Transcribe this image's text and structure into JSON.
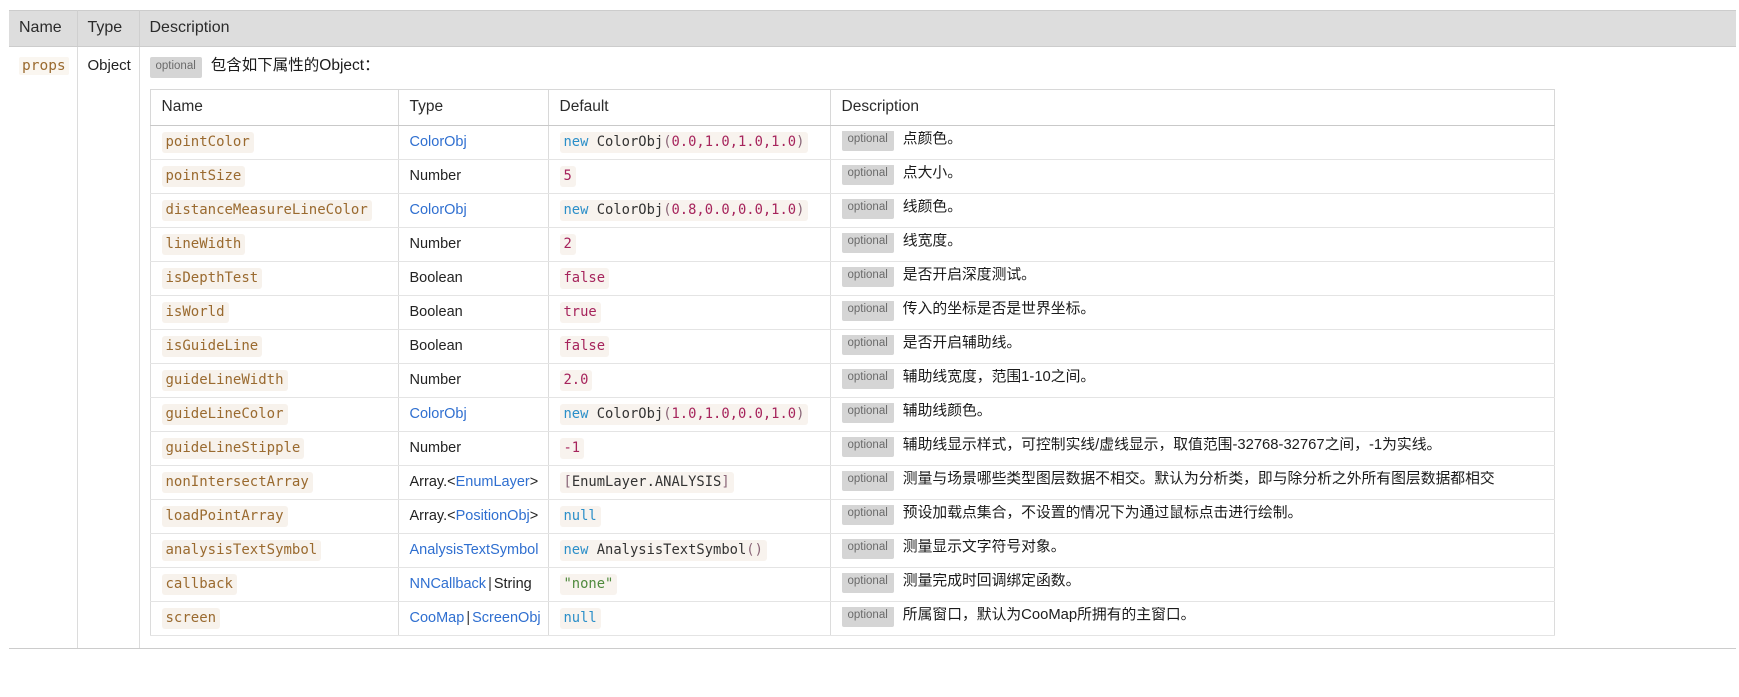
{
  "outer_table": {
    "headers": [
      "Name",
      "Type",
      "Description"
    ],
    "row": {
      "name": "props",
      "type": "Object",
      "optional_badge": "optional",
      "description": "包含如下属性的Object："
    }
  },
  "inner_table": {
    "headers": [
      "Name",
      "Type",
      "Default",
      "Description"
    ],
    "optional_badge": "optional",
    "rows": [
      {
        "name": "pointColor",
        "type": {
          "text": "ColorObj",
          "link": true
        },
        "default": {
          "text": "new ColorObj(0.0,1.0,1.0,1.0)",
          "tokens": [
            [
              "kw",
              "new"
            ],
            [
              "sp",
              " "
            ],
            [
              "id",
              "ColorObj"
            ],
            [
              "pun",
              "("
            ],
            [
              "num",
              "0.0,1.0,1.0,1.0"
            ],
            [
              "pun",
              ")"
            ]
          ]
        },
        "description": "点颜色。"
      },
      {
        "name": "pointSize",
        "type": {
          "text": "Number",
          "link": false
        },
        "default": {
          "text": "5",
          "tokens": [
            [
              "num",
              "5"
            ]
          ]
        },
        "description": "点大小。"
      },
      {
        "name": "distanceMeasureLineColor",
        "type": {
          "text": "ColorObj",
          "link": true
        },
        "default": {
          "text": "new ColorObj(0.8,0.0,0.0,1.0)",
          "tokens": [
            [
              "kw",
              "new"
            ],
            [
              "sp",
              " "
            ],
            [
              "id",
              "ColorObj"
            ],
            [
              "pun",
              "("
            ],
            [
              "num",
              "0.8,0.0,0.0,1.0"
            ],
            [
              "pun",
              ")"
            ]
          ]
        },
        "description": "线颜色。"
      },
      {
        "name": "lineWidth",
        "type": {
          "text": "Number",
          "link": false
        },
        "default": {
          "text": "2",
          "tokens": [
            [
              "num",
              "2"
            ]
          ]
        },
        "description": "线宽度。"
      },
      {
        "name": "isDepthTest",
        "type": {
          "text": "Boolean",
          "link": false
        },
        "default": {
          "text": "false",
          "tokens": [
            [
              "num",
              "false"
            ]
          ]
        },
        "description": "是否开启深度测试。"
      },
      {
        "name": "isWorld",
        "type": {
          "text": "Boolean",
          "link": false
        },
        "default": {
          "text": "true",
          "tokens": [
            [
              "num",
              "true"
            ]
          ]
        },
        "description": "传入的坐标是否是世界坐标。"
      },
      {
        "name": "isGuideLine",
        "type": {
          "text": "Boolean",
          "link": false
        },
        "default": {
          "text": "false",
          "tokens": [
            [
              "num",
              "false"
            ]
          ]
        },
        "description": "是否开启辅助线。"
      },
      {
        "name": "guideLineWidth",
        "type": {
          "text": "Number",
          "link": false
        },
        "default": {
          "text": "2.0",
          "tokens": [
            [
              "num",
              "2.0"
            ]
          ]
        },
        "description": "辅助线宽度，范围1-10之间。"
      },
      {
        "name": "guideLineColor",
        "type": {
          "text": "ColorObj",
          "link": true
        },
        "default": {
          "text": "new ColorObj(1.0,1.0,0.0,1.0)",
          "tokens": [
            [
              "kw",
              "new"
            ],
            [
              "sp",
              " "
            ],
            [
              "id",
              "ColorObj"
            ],
            [
              "pun",
              "("
            ],
            [
              "num",
              "1.0,1.0,0.0,1.0"
            ],
            [
              "pun",
              ")"
            ]
          ]
        },
        "description": "辅助线颜色。"
      },
      {
        "name": "guideLineStipple",
        "type": {
          "text": "Number",
          "link": false
        },
        "default": {
          "text": "-1",
          "tokens": [
            [
              "num",
              "-1"
            ]
          ]
        },
        "description": "辅助线显示样式，可控制实线/虚线显示，取值范围-32768-32767之间，-1为实线。"
      },
      {
        "name": "nonIntersectArray",
        "type": {
          "text": "Array.<EnumLayer>",
          "prefix": "Array.<",
          "link_text": "EnumLayer",
          "suffix": ">",
          "link": true
        },
        "default": {
          "text": "[EnumLayer.ANALYSIS]",
          "tokens": [
            [
              "pun",
              "["
            ],
            [
              "id",
              "EnumLayer.ANALYSIS"
            ],
            [
              "pun",
              "]"
            ]
          ]
        },
        "description": "测量与场景哪些类型图层数据不相交。默认为分析类，即与除分析之外所有图层数据都相交"
      },
      {
        "name": "loadPointArray",
        "type": {
          "text": "Array.<PositionObj>",
          "prefix": "Array.<",
          "link_text": "PositionObj",
          "suffix": ">",
          "link": true
        },
        "default": {
          "text": "null",
          "tokens": [
            [
              "null",
              "null"
            ]
          ]
        },
        "description": "预设加载点集合，不设置的情况下为通过鼠标点击进行绘制。"
      },
      {
        "name": "analysisTextSymbol",
        "type": {
          "text": "AnalysisTextSymbol",
          "link": true
        },
        "default": {
          "text": "new AnalysisTextSymbol()",
          "tokens": [
            [
              "kw",
              "new"
            ],
            [
              "sp",
              " "
            ],
            [
              "id",
              "AnalysisTextSymbol"
            ],
            [
              "pun",
              "()"
            ]
          ]
        },
        "description": "测量显示文字符号对象。"
      },
      {
        "name": "callback",
        "type": {
          "text": "NNCallback | String",
          "link_text": "NNCallback",
          "sep": "|",
          "plain_text": "String",
          "link": true
        },
        "default": {
          "text": "\"none\"",
          "tokens": [
            [
              "str",
              "\"none\""
            ]
          ]
        },
        "description": "测量完成时回调绑定函数。"
      },
      {
        "name": "screen",
        "type": {
          "text": "CooMap | ScreenObj",
          "link_text": "CooMap",
          "sep": "|",
          "link_text2": "ScreenObj",
          "link": true
        },
        "default": {
          "text": "null",
          "tokens": [
            [
              "null",
              "null"
            ]
          ]
        },
        "description": "所属窗口，默认为CooMap所拥有的主窗口。"
      }
    ]
  },
  "colors": {
    "param_name": "#9a6a2f",
    "type_link": "#2f6fd0",
    "number_literal": "#a6245c",
    "keyword": "#2b8fc9",
    "string_literal": "#4f8a3d",
    "badge_bg": "#d5d5d5",
    "header_bg": "#dddddd"
  }
}
